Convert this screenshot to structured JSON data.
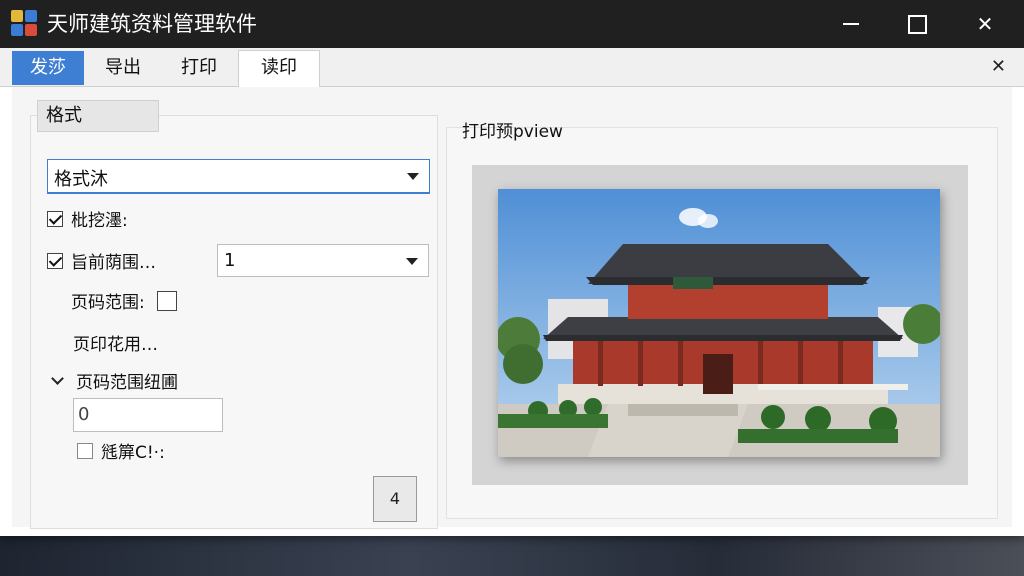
{
  "window": {
    "title": "天师建筑资料管理软件",
    "controls": {
      "minimize": "minimize",
      "maximize": "maximize",
      "close": "✕"
    }
  },
  "tabs": [
    {
      "label": "发莎",
      "state": "highlighted"
    },
    {
      "label": "导出"
    },
    {
      "label": "打印"
    },
    {
      "label": "读印",
      "state": "active"
    }
  ],
  "tab_close_glyph": "✕",
  "left_panel": {
    "group_label": "格式",
    "format_select": {
      "value": "格式沐"
    },
    "option_1": {
      "label": "枇挖濹:",
      "checked": true
    },
    "option_2": {
      "label": "旨前荫围…",
      "checked": true
    },
    "range_select": {
      "value": "1"
    },
    "page_range": {
      "label": "页码范围:",
      "checked": false
    },
    "print_usage": {
      "label": "页印花用…"
    },
    "expand_section": {
      "label": "页码范围纽圃"
    },
    "number_input": {
      "value": "0"
    },
    "option_3": {
      "label": "毤箳C!·:",
      "checked": false
    },
    "small_button": {
      "label": "4"
    }
  },
  "right_panel": {
    "label": "打印预pview",
    "image_alt": "Chinese traditional building photo"
  },
  "colors": {
    "accent": "#3e7ed3",
    "titlebar": "#202020"
  }
}
